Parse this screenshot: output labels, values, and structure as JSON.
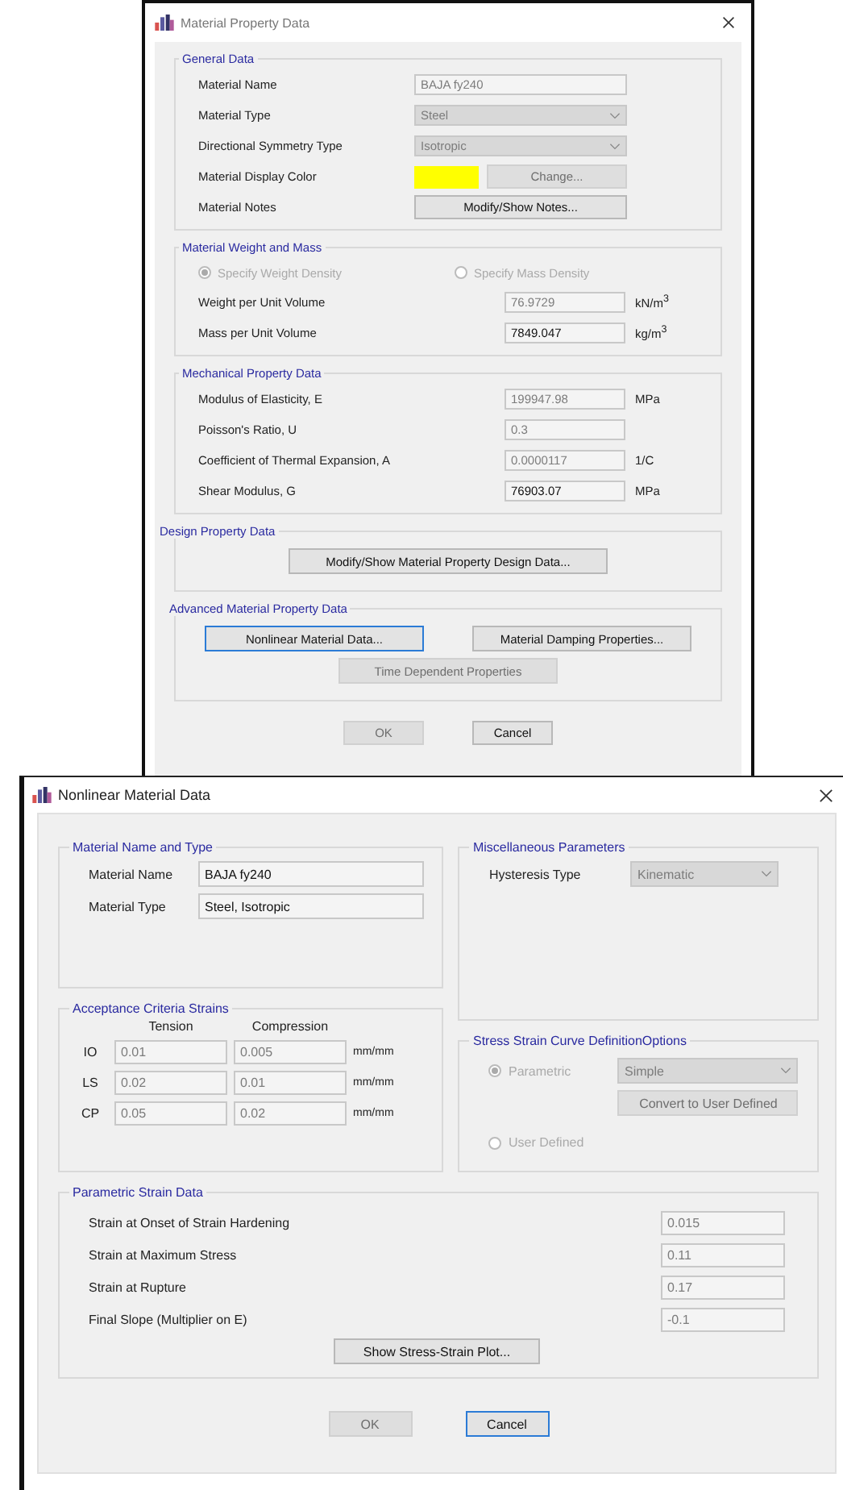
{
  "material_property_dialog": {
    "title": "Material Property Data",
    "general_data": {
      "title": "General Data",
      "rows": [
        {
          "label": "Material Name",
          "kind": "text",
          "value": "BAJA fy240",
          "disabled": true
        },
        {
          "label": "Material Type",
          "kind": "dropdown",
          "value": "Steel",
          "disabled": true
        },
        {
          "label": "Directional Symmetry Type",
          "kind": "dropdown",
          "value": "Isotropic",
          "disabled": true
        },
        {
          "label": "Material Display Color",
          "kind": "color",
          "color": "#ffff00",
          "button": "Change...",
          "disabled": true
        },
        {
          "label": "Material Notes",
          "kind": "button",
          "button": "Modify/Show Notes...",
          "disabled": false
        }
      ]
    },
    "weight_and_mass": {
      "title": "Material Weight and Mass",
      "options": [
        {
          "label": "Specify Weight Density",
          "selected": true,
          "disabled": true
        },
        {
          "label": "Specify Mass Density",
          "selected": false,
          "disabled": true
        }
      ],
      "rows": [
        {
          "label": "Weight per Unit Volume",
          "value": "76.9729",
          "unit": "kN/m$^{3}$",
          "disabled": true
        },
        {
          "label": "Mass per Unit Volume",
          "value": "7849.047",
          "unit": "kg/m$^{3}$",
          "disabled": false
        }
      ]
    },
    "mechanical_property_data": {
      "title": "Mechanical Property Data",
      "rows": [
        {
          "label": "Modulus of Elasticity,  E",
          "value": "199947.98",
          "unit": "MPa",
          "disabled": true
        },
        {
          "label": "Poisson's Ratio,  U",
          "value": "0.3",
          "disabled": true
        },
        {
          "label": "Coefficient of Thermal Expansion,  A",
          "value": "0.0000117",
          "unit": "1/C",
          "disabled": true
        },
        {
          "label": "Shear Modulus,  G",
          "value": "76903.07",
          "unit": "MPa",
          "disabled": false
        }
      ]
    },
    "design_property_data": {
      "title": "Design Property Data",
      "button": {
        "label": "Modify/Show Material Property Design Data...",
        "disabled": false
      }
    },
    "advanced_material_property_data": {
      "title": "Advanced Material Property Data",
      "buttons": [
        {
          "label": "Nonlinear Material Data...",
          "disabled": false,
          "focused": true
        },
        {
          "label": "Material Damping Properties...",
          "disabled": false,
          "focused": false
        },
        {
          "label": "Time Dependent Properties",
          "disabled": true,
          "focused": false
        }
      ]
    },
    "footer_buttons": [
      {
        "label": "OK",
        "disabled": true,
        "focused": false
      },
      {
        "label": "Cancel",
        "disabled": false,
        "focused": false
      }
    ]
  },
  "nonlinear_material_dialog": {
    "title": "Nonlinear Material Data",
    "material_name_and_type": {
      "title": "Material Name and Type",
      "rows": [
        {
          "label": "Material Name",
          "value": "BAJA fy240"
        },
        {
          "label": "Material Type",
          "value": "Steel, Isotropic"
        }
      ]
    },
    "miscellaneous_parameters": {
      "title": "Miscellaneous Parameters",
      "rows": [
        {
          "label": "Hysteresis Type",
          "value": "Kinematic",
          "disabled": true
        }
      ]
    },
    "acceptance_criteria_strains": {
      "title": "Acceptance Criteria Strains",
      "columns": [
        "Tension",
        "Compression"
      ],
      "rows": [
        {
          "label": "IO",
          "tension": "0.01",
          "compression": "0.005",
          "unit": "mm/mm"
        },
        {
          "label": "LS",
          "tension": "0.02",
          "compression": "0.01",
          "unit": "mm/mm"
        },
        {
          "label": "CP",
          "tension": "0.05",
          "compression": "0.02",
          "unit": "mm/mm"
        }
      ]
    },
    "stress_strain_curve_options": {
      "title": "Stress Strain Curve DefinitionOptions",
      "options": [
        {
          "label": "Parametric",
          "selected": true,
          "disabled": true
        },
        {
          "label": "User Defined",
          "selected": false,
          "disabled": true
        }
      ],
      "curve_type": {
        "value": "Simple",
        "disabled": true
      },
      "convert_button": {
        "label": "Convert to User Defined",
        "disabled": true
      }
    },
    "parametric_strain_data": {
      "title": "Parametric Strain Data",
      "rows": [
        {
          "label": "Strain at Onset of Strain Hardening",
          "value": "0.015"
        },
        {
          "label": "Strain at Maximum Stress",
          "value": "0.11"
        },
        {
          "label": "Strain at Rupture",
          "value": "0.17"
        },
        {
          "label": "Final Slope (Multiplier on E)",
          "value": "-0.1"
        }
      ],
      "plot_button": {
        "label": "Show Stress-Strain Plot...",
        "disabled": false
      }
    },
    "footer_buttons": [
      {
        "label": "OK",
        "disabled": true,
        "focused": false
      },
      {
        "label": "Cancel",
        "disabled": false,
        "focused": true
      }
    ]
  }
}
